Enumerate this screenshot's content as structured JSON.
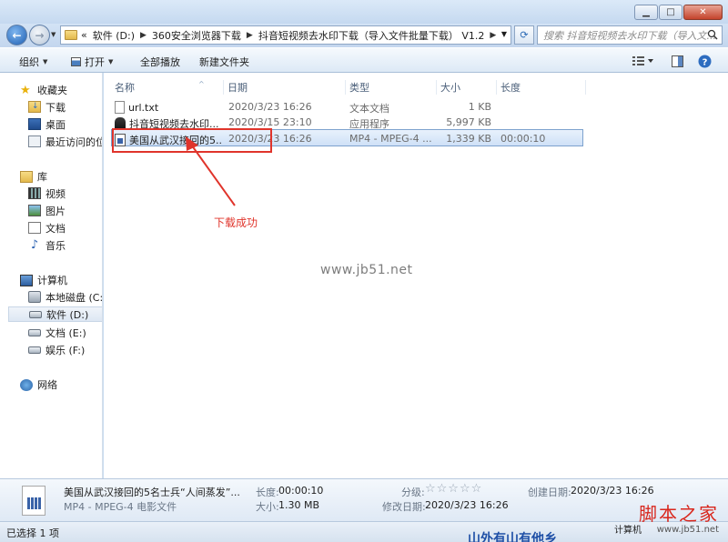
{
  "address": {
    "crumbs": [
      "软件 (D:)",
      "360安全浏览器下载",
      "抖音短视频去水印下载（导入文件批量下载） V1.2"
    ],
    "chevron": "«",
    "search_placeholder": "搜索 抖音短视频去水印下载（导入文..."
  },
  "toolbar": {
    "organize": "组织",
    "open": "打开",
    "play_all": "全部播放",
    "new_folder": "新建文件夹"
  },
  "sidebar": {
    "favorites": {
      "label": "收藏夹",
      "items": [
        {
          "label": "下载",
          "icon": "downloads-folder-icon"
        },
        {
          "label": "桌面",
          "icon": "desktop-icon"
        },
        {
          "label": "最近访问的位",
          "icon": "recent-places-icon"
        }
      ]
    },
    "libraries": {
      "label": "库",
      "items": [
        {
          "label": "视频",
          "icon": "video-library-icon"
        },
        {
          "label": "图片",
          "icon": "pictures-library-icon"
        },
        {
          "label": "文档",
          "icon": "documents-library-icon"
        },
        {
          "label": "音乐",
          "icon": "music-library-icon"
        }
      ]
    },
    "computer": {
      "label": "计算机",
      "items": [
        {
          "label": "本地磁盘 (C:)",
          "icon": "system-drive-icon"
        },
        {
          "label": "软件 (D:)",
          "icon": "drive-icon",
          "selected": true
        },
        {
          "label": "文档 (E:)",
          "icon": "drive-icon"
        },
        {
          "label": "娱乐 (F:)",
          "icon": "drive-icon"
        }
      ]
    },
    "network": {
      "label": "网络"
    }
  },
  "columns": {
    "name": "名称",
    "date": "日期",
    "type": "类型",
    "size": "大小",
    "length": "长度"
  },
  "files": [
    {
      "name": "url.txt",
      "date": "2020/3/23 16:26",
      "type": "文本文档",
      "size": "1 KB",
      "length": "",
      "icon": "text-file-icon"
    },
    {
      "name": "抖音短视频去水印...",
      "date": "2020/3/15 23:10",
      "type": "应用程序",
      "size": "5,997 KB",
      "length": "",
      "icon": "application-icon"
    },
    {
      "name": "美国从武汉接回的5...",
      "date": "2020/3/23 16:26",
      "type": "MP4 - MPEG-4 ...",
      "size": "1,339 KB",
      "length": "00:00:10",
      "icon": "video-file-icon",
      "selected": true
    }
  ],
  "annotation": {
    "text": "下载成功",
    "color": "#e0342b"
  },
  "watermark": "www.jb51.net",
  "details": {
    "filename": "美国从武汉接回的5名士兵“人间蒸发”...",
    "filetype": "MP4 - MPEG-4 电影文件",
    "length_label": "长度:",
    "length_value": "00:00:10",
    "size_label": "大小:",
    "size_value": "1.30 MB",
    "rating_label": "分级:",
    "rating_value": "☆☆☆☆☆",
    "modified_label": "修改日期:",
    "modified_value": "2020/3/23 16:26",
    "created_label": "创建日期:",
    "created_value": "2020/3/23 16:26"
  },
  "status": {
    "text": "已选择 1 项",
    "computer": "计算机"
  },
  "brand": {
    "name": "脚本之家",
    "url": "www.jb51.net"
  },
  "bottom_banner": "山外有山有他乡"
}
